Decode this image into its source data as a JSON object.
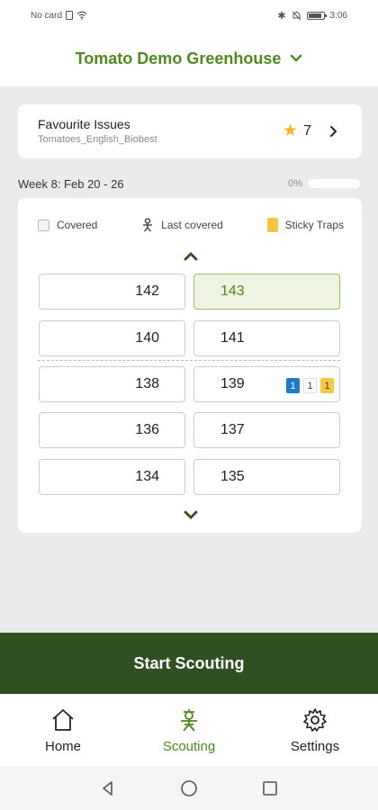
{
  "status_bar": {
    "carrier": "No card",
    "time": "3:06",
    "icons": [
      "sim-icon",
      "wifi-icon",
      "bluetooth-icon",
      "mute-icon",
      "battery-icon"
    ]
  },
  "header": {
    "title": "Tomato Demo Greenhouse",
    "icon": "chevron-down-icon"
  },
  "favourites": {
    "title": "Favourite Issues",
    "subtitle": "Tomatoes_English_Biobest",
    "count": "7",
    "icon": "star-icon"
  },
  "week": {
    "label": "Week 8: Feb 20 - 26",
    "progress_text": "0%",
    "progress": 0
  },
  "legend": {
    "covered": "Covered",
    "last_covered": "Last covered",
    "sticky_traps": "Sticky Traps"
  },
  "rows": [
    {
      "left": "142",
      "right": "143",
      "right_selected": true
    },
    {
      "left": "140",
      "right": "141"
    },
    {
      "left": "138",
      "right": "139",
      "badges": [
        "1",
        "1",
        "1"
      ]
    },
    {
      "left": "136",
      "right": "137"
    },
    {
      "left": "134",
      "right": "135"
    }
  ],
  "actions": {
    "start": "Start Scouting"
  },
  "tabs": [
    {
      "label": "Home",
      "icon": "home-icon"
    },
    {
      "label": "Scouting",
      "icon": "scout-icon",
      "active": true
    },
    {
      "label": "Settings",
      "icon": "gear-icon"
    }
  ],
  "colors": {
    "brand_green": "#4e8a1f",
    "button_dark_green": "#2f5122",
    "sticky_yellow": "#f5c742",
    "badge_blue": "#1d79c9"
  }
}
